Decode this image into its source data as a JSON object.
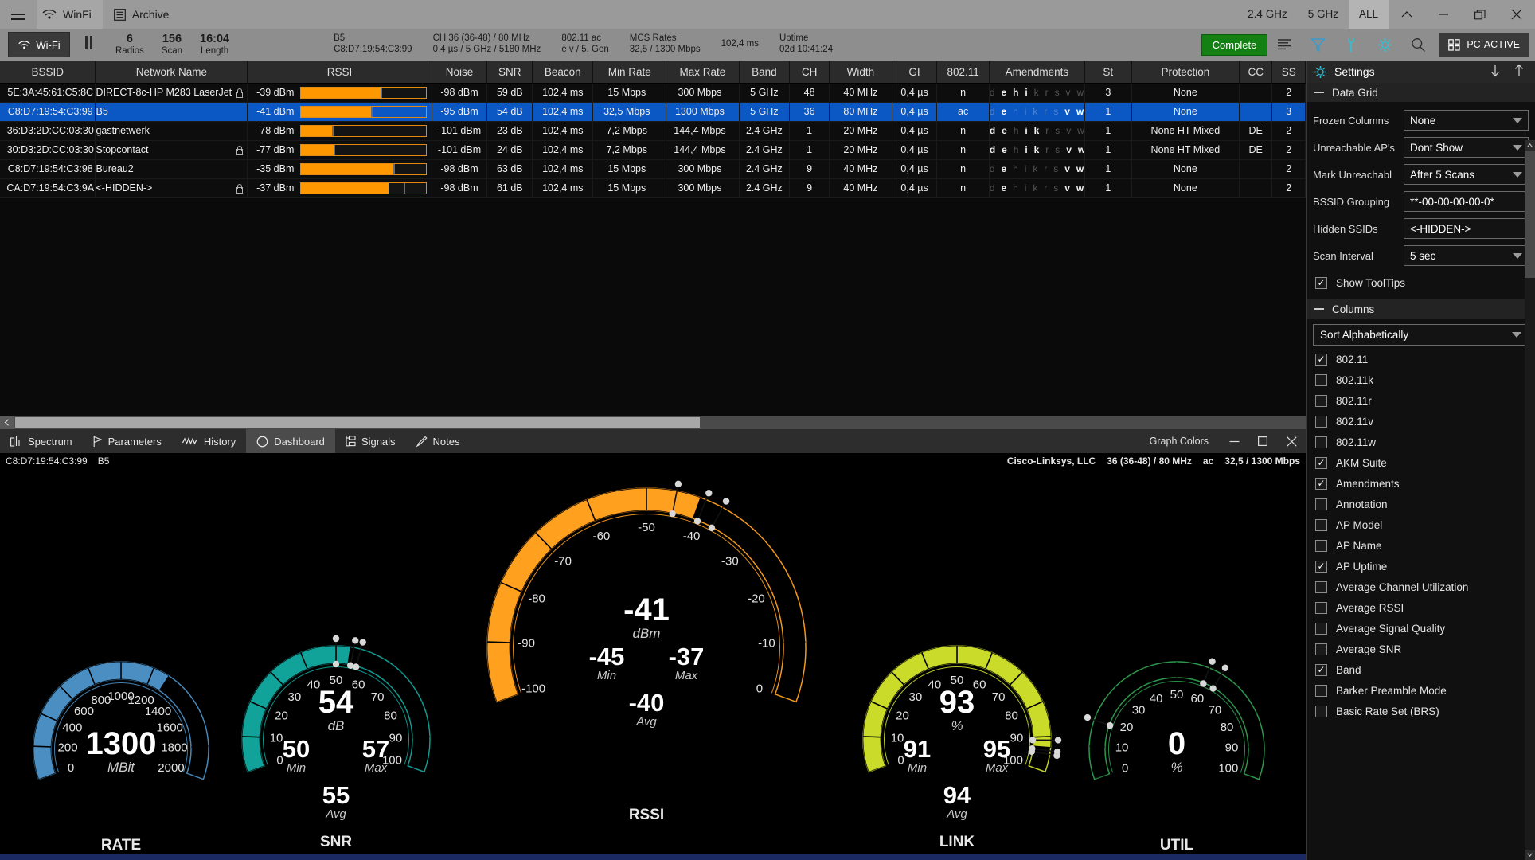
{
  "titlebar": {
    "app_name": "WinFi",
    "archive_label": "Archive",
    "band_24": "2.4 GHz",
    "band_5": "5 GHz",
    "band_all": "ALL"
  },
  "toolbar": {
    "wifi_label": "Wi-Fi",
    "stats": [
      {
        "value": "6",
        "label": "Radios"
      },
      {
        "value": "156",
        "label": "Scan"
      },
      {
        "value": "16:04",
        "label": "Length"
      }
    ],
    "blocks": [
      {
        "a": "B5",
        "b": "C8:D7:19:54:C3:99"
      },
      {
        "a": "CH  36 (36-48)  /  80 MHz",
        "b": "0,4 µs / 5 GHz / 5180 MHz"
      },
      {
        "a": "802.11 ac",
        "b": "e v / 5. Gen"
      },
      {
        "a": "MCS Rates",
        "b": "32,5 / 1300 Mbps"
      },
      {
        "a": "102,4 ms",
        "b": ""
      },
      {
        "a": "Uptime",
        "b": "02d 10:41:24"
      }
    ],
    "complete_label": "Complete",
    "pc_active_label": "PC-ACTIVE"
  },
  "grid": {
    "columns": [
      "BSSID",
      "Network Name",
      "RSSI",
      "Noise",
      "SNR",
      "Beacon",
      "Min Rate",
      "Max Rate",
      "Band",
      "CH",
      "Width",
      "GI",
      "802.11",
      "Amendments",
      "St",
      "Protection",
      "CC",
      "SS"
    ],
    "rows": [
      {
        "bssid": "5E:3A:45:61:C5:8C",
        "name": "DIRECT-8c-HP M283 LaserJet",
        "locked": true,
        "rssi": "-39 dBm",
        "rssi_pct": 64,
        "rssi_tick": 64,
        "noise": "-98 dBm",
        "snr": "59 dB",
        "beacon": "102,4 ms",
        "min_rate": "15 Mbps",
        "max_rate": "300 Mbps",
        "band": "5 GHz",
        "ch": "48",
        "width": "40 MHz",
        "gi": "0,4 µs",
        "dot11": "n",
        "amendments": "d e h i k r s v w",
        "amd_on": [
          1,
          2,
          3
        ],
        "st": "3",
        "protection": "None",
        "cc": "",
        "ss": "2",
        "selected": false
      },
      {
        "bssid": "C8:D7:19:54:C3:99",
        "name": "B5",
        "locked": false,
        "rssi": "-41 dBm",
        "rssi_pct": 56,
        "rssi_tick": 56,
        "noise": "-95 dBm",
        "snr": "54 dB",
        "beacon": "102,4 ms",
        "min_rate": "32,5 Mbps",
        "max_rate": "1300 Mbps",
        "band": "5 GHz",
        "ch": "36",
        "width": "80 MHz",
        "gi": "0,4 µs",
        "dot11": "ac",
        "amendments": "d e h i k r s v w",
        "amd_on": [
          1,
          7,
          8
        ],
        "st": "1",
        "protection": "None",
        "cc": "",
        "ss": "3",
        "selected": true
      },
      {
        "bssid": "36:D3:2D:CC:03:30",
        "name": "gastnetwerk",
        "locked": false,
        "rssi": "-78 dBm",
        "rssi_pct": 25,
        "rssi_tick": 25,
        "noise": "-101 dBm",
        "snr": "23 dB",
        "beacon": "102,4 ms",
        "min_rate": "7,2 Mbps",
        "max_rate": "144,4 Mbps",
        "band": "2.4 GHz",
        "ch": "1",
        "width": "20 MHz",
        "gi": "0,4 µs",
        "dot11": "n",
        "amendments": "d e h i k r s v w",
        "amd_on": [
          0,
          1,
          3,
          4
        ],
        "st": "1",
        "protection": "None HT Mixed",
        "cc": "DE",
        "ss": "2",
        "selected": false
      },
      {
        "bssid": "30:D3:2D:CC:03:30",
        "name": "Stopcontact",
        "locked": true,
        "rssi": "-77 dBm",
        "rssi_pct": 26,
        "rssi_tick": 26,
        "noise": "-101 dBm",
        "snr": "24 dB",
        "beacon": "102,4 ms",
        "min_rate": "7,2 Mbps",
        "max_rate": "144,4 Mbps",
        "band": "2.4 GHz",
        "ch": "1",
        "width": "20 MHz",
        "gi": "0,4 µs",
        "dot11": "n",
        "amendments": "d e h i k r s v w",
        "amd_on": [
          0,
          1,
          3,
          4,
          7,
          8
        ],
        "st": "1",
        "protection": "None HT Mixed",
        "cc": "DE",
        "ss": "2",
        "selected": false
      },
      {
        "bssid": "C8:D7:19:54:C3:98",
        "name": "Bureau2",
        "locked": false,
        "rssi": "-35 dBm",
        "rssi_pct": 74,
        "rssi_tick": 74,
        "noise": "-98 dBm",
        "snr": "63 dB",
        "beacon": "102,4 ms",
        "min_rate": "15 Mbps",
        "max_rate": "300 Mbps",
        "band": "2.4 GHz",
        "ch": "9",
        "width": "40 MHz",
        "gi": "0,4 µs",
        "dot11": "n",
        "amendments": "d e h i k r s v w",
        "amd_on": [
          1,
          7,
          8
        ],
        "st": "1",
        "protection": "None",
        "cc": "",
        "ss": "2",
        "selected": false
      },
      {
        "bssid": "CA:D7:19:54:C3:9A",
        "name": "<-HIDDEN->",
        "locked": true,
        "rssi": "-37 dBm",
        "rssi_pct": 70,
        "rssi_tick": 82,
        "noise": "-98 dBm",
        "snr": "61 dB",
        "beacon": "102,4 ms",
        "min_rate": "15 Mbps",
        "max_rate": "300 Mbps",
        "band": "2.4 GHz",
        "ch": "9",
        "width": "40 MHz",
        "gi": "0,4 µs",
        "dot11": "n",
        "amendments": "d e h i k r s v w",
        "amd_on": [
          1,
          7,
          8
        ],
        "st": "1",
        "protection": "None",
        "cc": "",
        "ss": "2",
        "selected": false
      }
    ]
  },
  "tabs": [
    {
      "label": "Spectrum",
      "icon": "spectrum-icon",
      "active": false
    },
    {
      "label": "Parameters",
      "icon": "flag-icon",
      "active": false
    },
    {
      "label": "History",
      "icon": "wave-icon",
      "active": false
    },
    {
      "label": "Dashboard",
      "icon": "gauge-icon",
      "active": true
    },
    {
      "label": "Signals",
      "icon": "signals-icon",
      "active": false
    },
    {
      "label": "Notes",
      "icon": "pencil-icon",
      "active": false
    }
  ],
  "panel": {
    "graph_colors_label": "Graph Colors",
    "info_left": [
      "C8:D7:19:54:C3:99",
      "B5"
    ],
    "info_right": [
      "Cisco-Linksys, LLC",
      "36 (36-48)  /  80 MHz",
      "ac",
      "32,5 / 1300 Mbps"
    ]
  },
  "chart_data": [
    {
      "type": "gauge",
      "name": "RATE",
      "unit": "MBit",
      "value": 1300,
      "min": 0,
      "max": 2000,
      "ticks": [
        0,
        200,
        400,
        600,
        800,
        1000,
        1200,
        1400,
        1600,
        1800,
        2000
      ],
      "color": "#4a8ec2",
      "track": "#0f2336",
      "readouts": [
        {
          "value": "1300",
          "label": "MBit",
          "size": "big"
        }
      ]
    },
    {
      "type": "gauge",
      "name": "SNR",
      "unit": "dB",
      "value": 54,
      "min": 0,
      "max": 100,
      "ticks": [
        0,
        10,
        20,
        30,
        40,
        50,
        60,
        70,
        80,
        90,
        100
      ],
      "color": "#11a39a",
      "track": "#06302e",
      "min_marker": 50,
      "max_marker": 57,
      "avg_marker": 55,
      "readouts": [
        {
          "value": "54",
          "label": "dB",
          "size": "big"
        },
        {
          "value": "50",
          "label": "Min",
          "size": "mid"
        },
        {
          "value": "57",
          "label": "Max",
          "size": "mid"
        },
        {
          "value": "55",
          "label": "Avg",
          "size": "mid"
        }
      ]
    },
    {
      "type": "gauge",
      "name": "RSSI",
      "unit": "dBm",
      "value": -41,
      "min": -100,
      "max": 0,
      "ticks": [
        -100,
        -90,
        -80,
        -70,
        -60,
        -50,
        -40,
        -30,
        -20,
        -10,
        0
      ],
      "color": "#ffa01e",
      "track": "#3a2600",
      "min_marker": -45,
      "max_marker": -37,
      "avg_marker": -40,
      "readouts": [
        {
          "value": "-41",
          "label": "dBm",
          "size": "big"
        },
        {
          "value": "-45",
          "label": "Min",
          "size": "mid"
        },
        {
          "value": "-37",
          "label": "Max",
          "size": "mid"
        },
        {
          "value": "-40",
          "label": "Avg",
          "size": "mid"
        }
      ]
    },
    {
      "type": "gauge",
      "name": "LINK",
      "unit": "%",
      "value": 93,
      "min": 0,
      "max": 100,
      "ticks": [
        0,
        10,
        20,
        30,
        40,
        50,
        60,
        70,
        80,
        90,
        100
      ],
      "color": "#cbdb2a",
      "track": "#2e3205",
      "min_marker": 91,
      "max_marker": 95,
      "avg_marker": 94,
      "readouts": [
        {
          "value": "93",
          "label": "%",
          "size": "big"
        },
        {
          "value": "91",
          "label": "Min",
          "size": "mid"
        },
        {
          "value": "95",
          "label": "Max",
          "size": "mid"
        },
        {
          "value": "94",
          "label": "Avg",
          "size": "mid"
        }
      ]
    },
    {
      "type": "gauge",
      "name": "UTIL",
      "unit": "%",
      "value": 0,
      "min": 0,
      "max": 100,
      "ticks": [
        0,
        10,
        20,
        30,
        40,
        50,
        60,
        70,
        80,
        90,
        100
      ],
      "color": "#2f9e4f",
      "track": "#07240f",
      "min_marker": 18,
      "max_marker": 64,
      "avg_marker": 60,
      "readouts": [
        {
          "value": "0",
          "label": "%",
          "size": "big"
        }
      ]
    }
  ],
  "settings": {
    "title": "Settings",
    "data_grid_section": "Data Grid",
    "rows": [
      {
        "label": "Frozen Columns",
        "value": "None",
        "type": "select"
      },
      {
        "label": "Unreachable AP's",
        "value": "Dont Show",
        "type": "select"
      },
      {
        "label": "Mark Unreachabl",
        "value": "After 5 Scans",
        "type": "select"
      },
      {
        "label": "BSSID Grouping",
        "value": "**-00-00-00-00-0*",
        "type": "text"
      },
      {
        "label": "Hidden SSIDs",
        "value": "<-HIDDEN->",
        "type": "text"
      },
      {
        "label": "Scan Interval",
        "value": "5 sec",
        "type": "select"
      }
    ],
    "show_tooltips": {
      "label": "Show ToolTips",
      "checked": true
    },
    "columns_section": "Columns",
    "sort_label": "Sort Alphabetically",
    "column_items": [
      {
        "label": "802.11",
        "checked": true
      },
      {
        "label": "802.11k",
        "checked": false
      },
      {
        "label": "802.11r",
        "checked": false
      },
      {
        "label": "802.11v",
        "checked": false
      },
      {
        "label": "802.11w",
        "checked": false
      },
      {
        "label": "AKM Suite",
        "checked": true
      },
      {
        "label": "Amendments",
        "checked": true
      },
      {
        "label": "Annotation",
        "checked": false
      },
      {
        "label": "AP Model",
        "checked": false
      },
      {
        "label": "AP Name",
        "checked": false
      },
      {
        "label": "AP Uptime",
        "checked": true
      },
      {
        "label": "Average Channel Utilization",
        "checked": false
      },
      {
        "label": "Average RSSI",
        "checked": false
      },
      {
        "label": "Average Signal Quality",
        "checked": false
      },
      {
        "label": "Average SNR",
        "checked": false
      },
      {
        "label": "Band",
        "checked": true
      },
      {
        "label": "Barker Preamble Mode",
        "checked": false
      },
      {
        "label": "Basic Rate Set (BRS)",
        "checked": false
      }
    ]
  }
}
